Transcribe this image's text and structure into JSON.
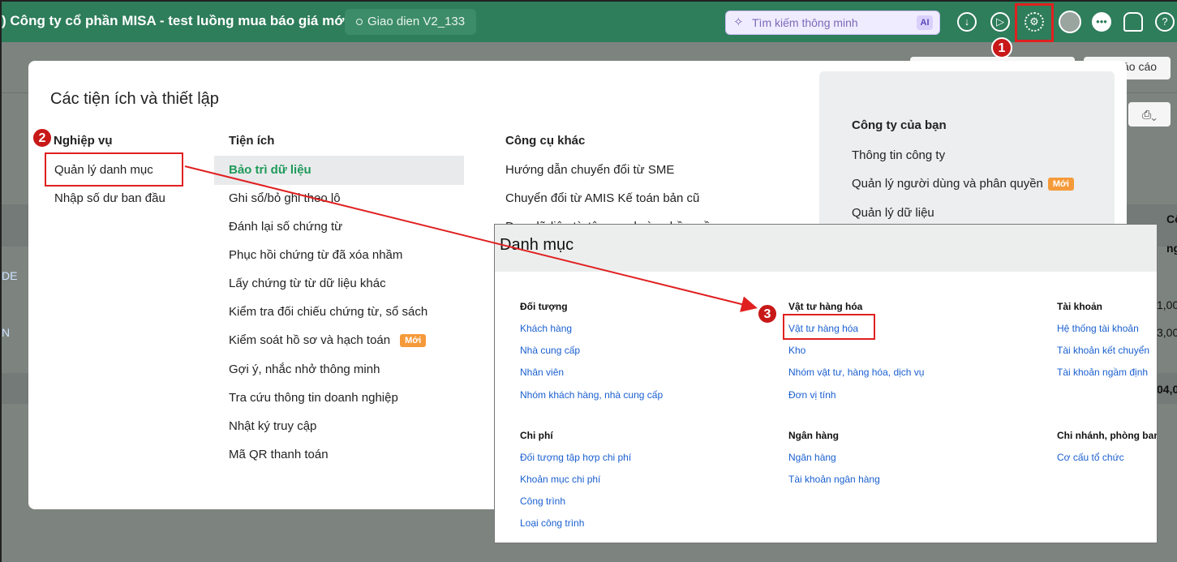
{
  "topbar": {
    "company": "Công ty cổ phần MISA - test luồng mua báo giá mới",
    "company_prefix": ")",
    "ui_version": "Giao dien V2_133",
    "search_placeholder": "Tìm kiếm thông minh",
    "ai_label": "AI",
    "colors": {
      "bar": "#2e7d5b",
      "highlight": "#e02020"
    }
  },
  "background": {
    "report_btn": "áo cáo",
    "side_texts": [
      "DE",
      "N"
    ],
    "right_texts": [
      "Cô",
      "ng",
      "1,00",
      "3,00",
      "04,0"
    ]
  },
  "modal": {
    "title": "Các tiện ích và thiết lập",
    "nghiep_vu": {
      "heading": "Nghiệp vụ",
      "items": [
        "Quản lý danh mục",
        "Nhập số dư ban đầu"
      ]
    },
    "tien_ich": {
      "heading": "Tiện ích",
      "items": [
        "Bảo trì dữ liệu",
        "Ghi sổ/bỏ ghi theo lô",
        "Đánh lại số chứng từ",
        "Phục hồi chứng từ đã xóa nhầm",
        "Lấy chứng từ từ dữ liệu khác",
        "Kiểm tra đối chiếu chứng từ, sổ sách",
        "Kiểm soát hồ sơ và hạch toán",
        "Gợi ý, nhắc nhở thông minh",
        "Tra cứu thông tin doanh nghiệp",
        "Nhật ký truy cập",
        "Mã QR thanh toán"
      ],
      "new_badge": "Mới"
    },
    "cong_cu_khac": {
      "heading": "Công cụ khác",
      "items": [
        "Hướng dẫn chuyển đổi từ SME",
        "Chuyển đổi từ AMIS Kế toán bản cũ",
        "Đưa dữ liệu từ tệp excel vào phần mềm"
      ]
    },
    "cong_ty": {
      "heading": "Công ty của bạn",
      "items": [
        "Thông tin công ty",
        "Quản lý người dùng và phân quyền",
        "Quản lý dữ liệu"
      ],
      "new_badge": "Mới"
    }
  },
  "steps": [
    "1",
    "2",
    "3"
  ],
  "danh_muc": {
    "title": "Danh mục",
    "groups": {
      "doi_tuong": {
        "heading": "Đối tượng",
        "items": [
          "Khách hàng",
          "Nhà cung cấp",
          "Nhân viên",
          "Nhóm khách hàng, nhà cung cấp"
        ]
      },
      "vat_tu": {
        "heading": "Vật tư hàng hóa",
        "items": [
          "Vật tư hàng hóa",
          "Kho",
          "Nhóm vật tư, hàng hóa, dịch vụ",
          "Đơn vị tính"
        ]
      },
      "tai_khoan": {
        "heading": "Tài khoản",
        "items": [
          "Hệ thống tài khoản",
          "Tài khoản kết chuyển",
          "Tài khoản ngầm định"
        ]
      },
      "chi_phi": {
        "heading": "Chi phí",
        "items": [
          "Đối tượng tập hợp chi phí",
          "Khoản mục chi phí",
          "Công trình",
          "Loại công trình"
        ]
      },
      "ngan_hang": {
        "heading": "Ngân hàng",
        "items": [
          "Ngân hàng",
          "Tài khoản ngân hàng"
        ]
      },
      "chi_nhanh": {
        "heading": "Chi nhánh, phòng ban",
        "items": [
          "Cơ cấu tổ chức"
        ]
      }
    }
  }
}
